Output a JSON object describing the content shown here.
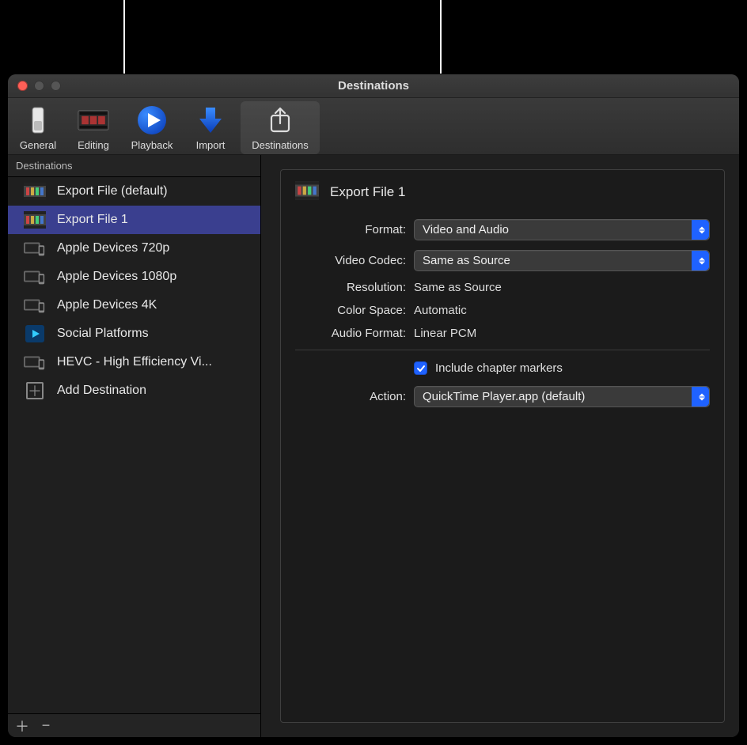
{
  "window": {
    "title": "Destinations"
  },
  "toolbar": {
    "items": [
      {
        "label": "General",
        "icon": "slider-icon"
      },
      {
        "label": "Editing",
        "icon": "filmstrip-icon"
      },
      {
        "label": "Playback",
        "icon": "play-circle-icon"
      },
      {
        "label": "Import",
        "icon": "arrow-down-icon"
      },
      {
        "label": "Destinations",
        "icon": "share-icon",
        "selected": true
      }
    ]
  },
  "sidebar": {
    "header": "Destinations",
    "items": [
      {
        "label": "Export File (default)",
        "icon": "film"
      },
      {
        "label": "Export File 1",
        "icon": "film",
        "selected": true
      },
      {
        "label": "Apple Devices 720p",
        "icon": "devices"
      },
      {
        "label": "Apple Devices 1080p",
        "icon": "devices"
      },
      {
        "label": "Apple Devices 4K",
        "icon": "devices"
      },
      {
        "label": "Social Platforms",
        "icon": "social"
      },
      {
        "label": "HEVC - High Efficiency Vi...",
        "icon": "devices"
      },
      {
        "label": "Add Destination",
        "icon": "add"
      }
    ]
  },
  "details": {
    "title": "Export File 1",
    "format_label": "Format:",
    "format_value": "Video and Audio",
    "codec_label": "Video Codec:",
    "codec_value": "Same as Source",
    "resolution_label": "Resolution:",
    "resolution_value": "Same as Source",
    "colorspace_label": "Color Space:",
    "colorspace_value": "Automatic",
    "audioformat_label": "Audio Format:",
    "audioformat_value": "Linear PCM",
    "chapter_markers_label": "Include chapter markers",
    "chapter_markers_checked": true,
    "action_label": "Action:",
    "action_value": "QuickTime Player.app (default)"
  }
}
